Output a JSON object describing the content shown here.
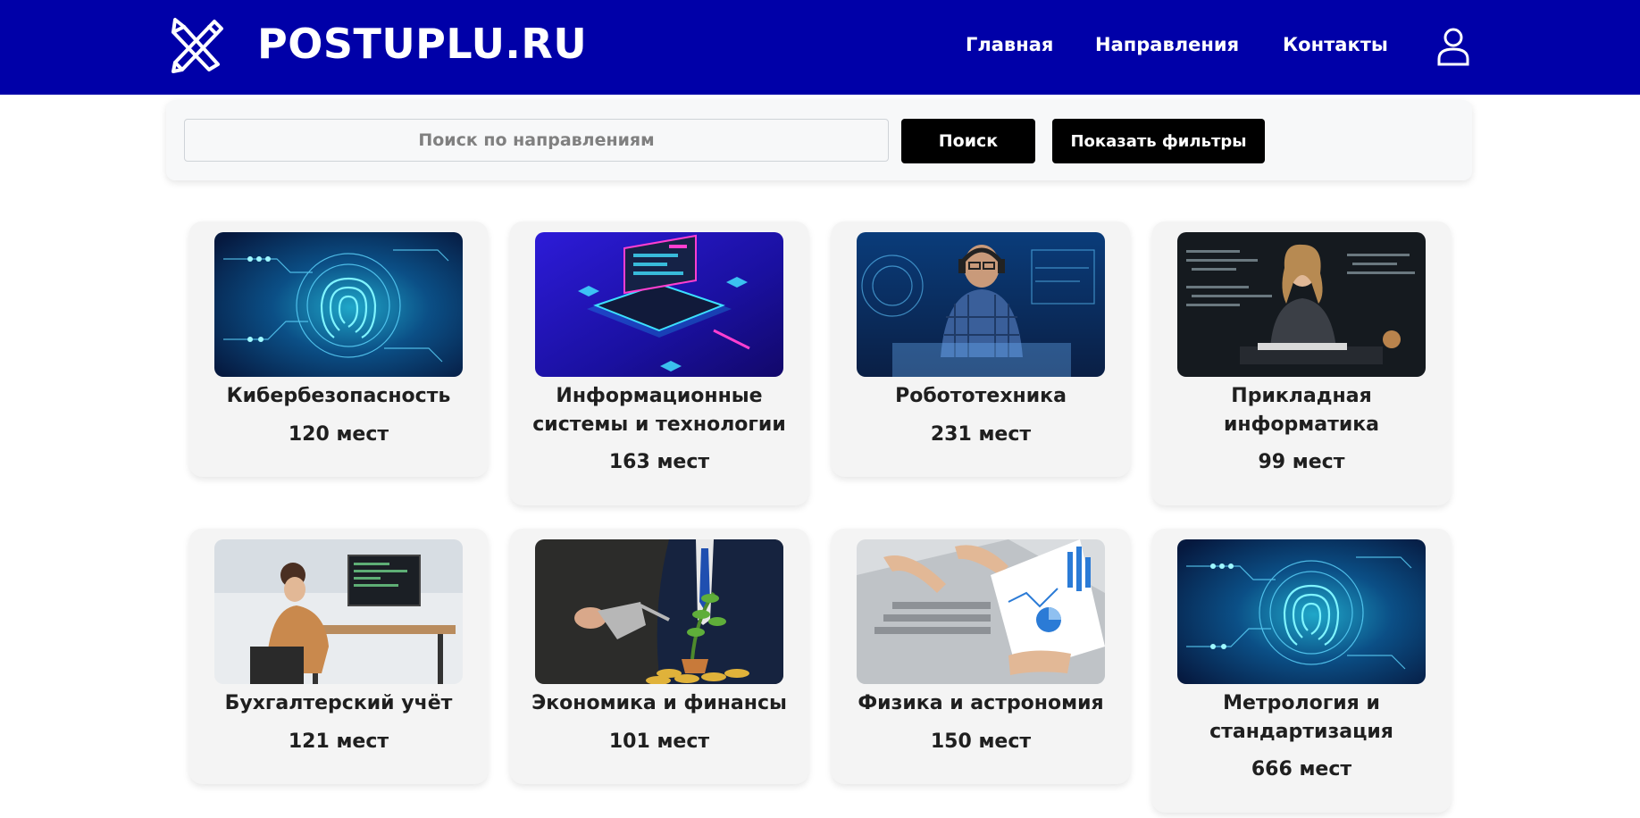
{
  "header": {
    "brand": "POSTUPLU.RU",
    "logo_icon": "crossed-pencil-ruler-icon",
    "nav": {
      "home": "Главная",
      "directions": "Направления",
      "contacts": "Контакты"
    },
    "user_icon": "user-profile-icon",
    "bg_color": "#0000a8"
  },
  "search": {
    "placeholder": "Поиск по направлениям",
    "value": "",
    "search_button": "Поиск",
    "filters_button": "Показать фильтры"
  },
  "cards": [
    {
      "title": "Кибербезопасность",
      "seats": "120 мест",
      "image": "fingerprint-cyber-image"
    },
    {
      "title": "Информационные системы и технологии",
      "title_line1": "Информационные",
      "title_line2": "системы и технологии",
      "seats": "163 мест",
      "image": "isometric-laptop-image"
    },
    {
      "title": "Робототехника",
      "seats": "231 мест",
      "image": "developer-headphones-image"
    },
    {
      "title": "Прикладная информатика",
      "title_line1": "Прикладная",
      "title_line2": "информатика",
      "seats": "99 мест",
      "image": "woman-coding-image"
    },
    {
      "title": "Бухгалтерский учёт",
      "seats": "121 мест",
      "image": "office-workstation-image"
    },
    {
      "title": "Экономика и финансы",
      "seats": "101 мест",
      "image": "watering-money-plant-image"
    },
    {
      "title": "Физика и астрономия",
      "seats": "150 мест",
      "image": "laptop-charts-image"
    },
    {
      "title": "Метрология и стандартизация",
      "title_line1": "Метрология и",
      "title_line2": "стандартизация",
      "seats": "666 мест",
      "image": "fingerprint-cyber-image"
    }
  ]
}
